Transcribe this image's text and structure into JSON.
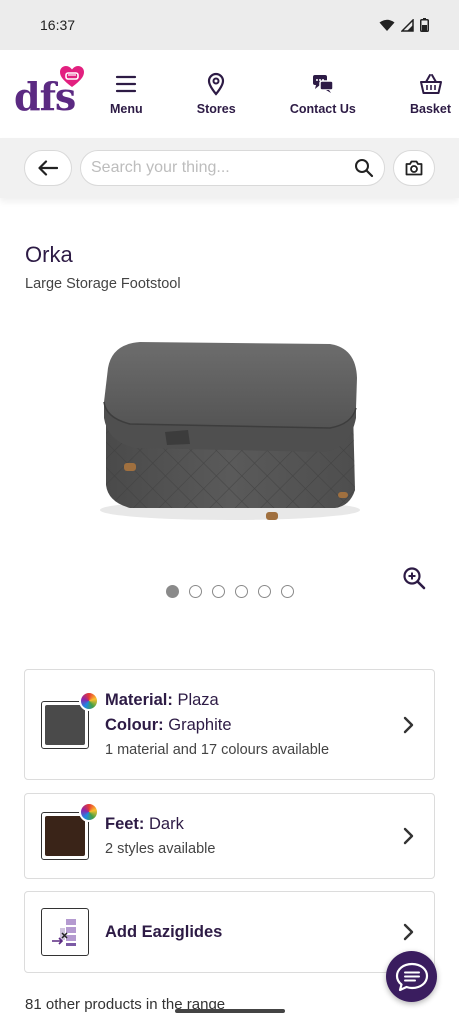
{
  "status_bar": {
    "time": "16:37"
  },
  "header": {
    "logo_text": "dfs",
    "nav": [
      {
        "label": "Menu",
        "icon": "hamburger-icon"
      },
      {
        "label": "Stores",
        "icon": "location-pin-icon"
      },
      {
        "label": "Contact Us",
        "icon": "chat-bubbles-icon"
      },
      {
        "label": "Basket",
        "icon": "basket-icon"
      }
    ]
  },
  "search": {
    "placeholder": "Search your thing...",
    "value": ""
  },
  "product": {
    "name": "Orka",
    "subtitle": "Large Storage Footstool",
    "image_count": 6,
    "active_image": 1
  },
  "options": {
    "material": {
      "material_label": "Material:",
      "material_value": "Plaza",
      "colour_label": "Colour:",
      "colour_value": "Graphite",
      "availability": "1 material and 17 colours available",
      "swatch_color": "#4a4a4a"
    },
    "feet": {
      "label": "Feet:",
      "value": "Dark",
      "availability": "2 styles available",
      "swatch_color": "#3a2418"
    },
    "eaziglides": {
      "label": "Add Eaziglides"
    }
  },
  "range_text": "81 other products in the range",
  "colors": {
    "brand_purple": "#5b2a82",
    "dark_purple": "#2d1b45",
    "heart_pink": "#e2207f"
  }
}
